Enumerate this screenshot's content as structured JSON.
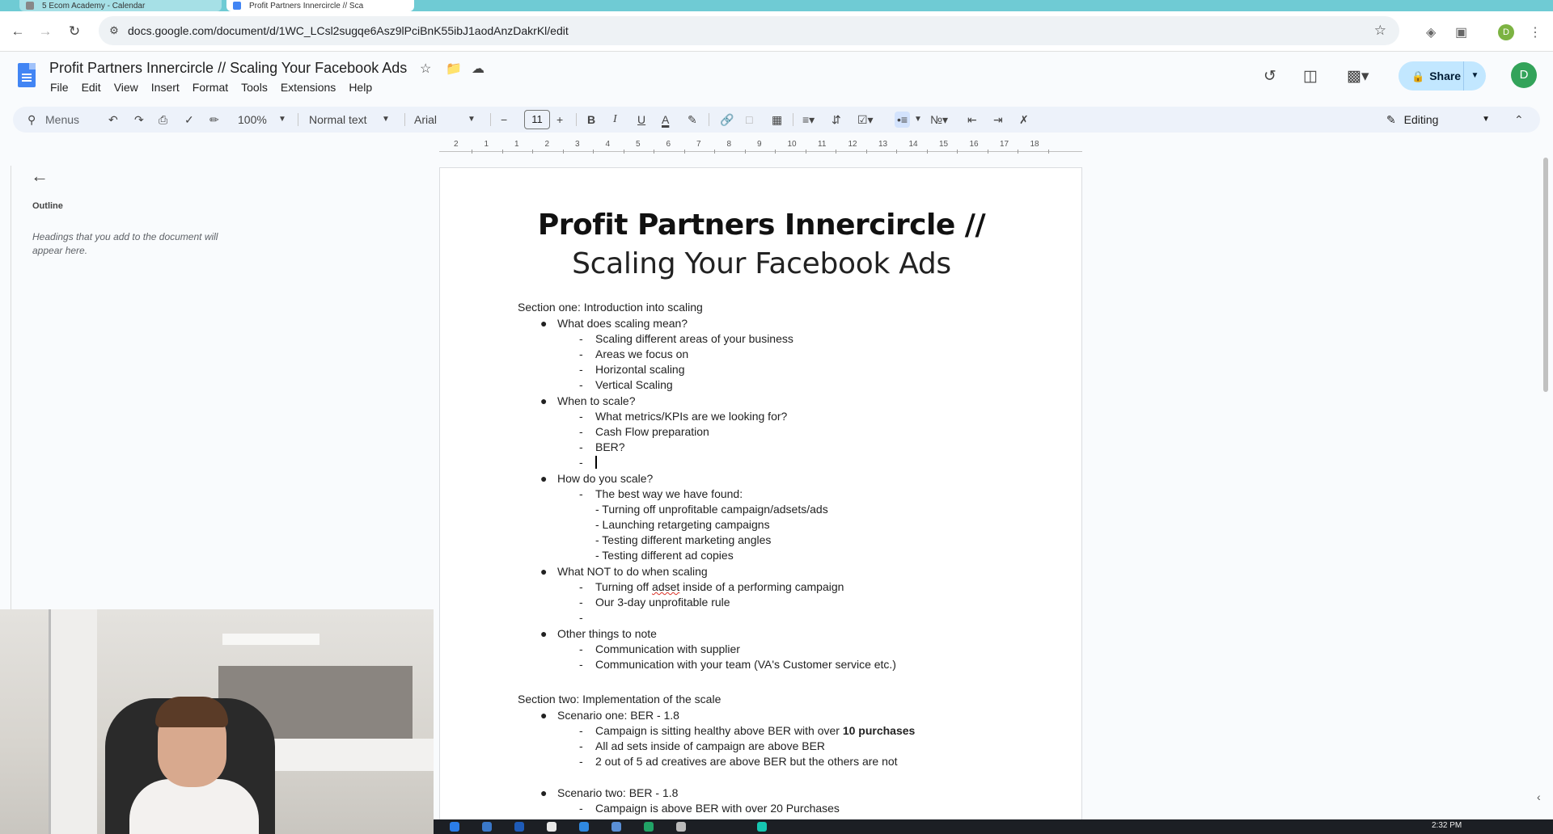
{
  "browser": {
    "tabs": [
      {
        "label": "5 Ecom Academy - Calendar"
      },
      {
        "label": "Profit Partners Innercircle // Sca"
      }
    ],
    "url": "docs.google.com/document/d/1WC_LCsl2sugqe6Asz9lPciBnK55ibJ1aodAnzDakrKl/edit",
    "profile_initial": "D"
  },
  "docs": {
    "title": "Profit Partners Innercircle // Scaling Your Facebook Ads",
    "menu": [
      "File",
      "Edit",
      "View",
      "Insert",
      "Format",
      "Tools",
      "Extensions",
      "Help"
    ],
    "share_label": "Share",
    "account_initial": "D"
  },
  "toolbar": {
    "menus_label": "Menus",
    "zoom": "100%",
    "style": "Normal text",
    "font": "Arial",
    "font_size": "11",
    "mode": "Editing"
  },
  "outline": {
    "label": "Outline",
    "hint": "Headings that you add to the document will appear here."
  },
  "ruler": {
    "numbers": [
      "2",
      "1",
      "1",
      "2",
      "3",
      "4",
      "5",
      "6",
      "7",
      "8",
      "9",
      "10",
      "11",
      "12",
      "13",
      "14",
      "15",
      "16",
      "17",
      "18"
    ]
  },
  "document": {
    "heading1": "Profit Partners Innercircle //",
    "heading2": "Scaling Your Facebook Ads",
    "section1": "Section one: Introduction into scaling",
    "b1": "What does scaling mean?",
    "b1_subs": [
      "Scaling different areas of your business",
      "Areas we focus on",
      "Horizontal scaling",
      "Vertical Scaling"
    ],
    "b2": "When to scale?",
    "b2_subs": [
      "What metrics/KPIs are we looking for?",
      "Cash Flow preparation",
      "BER?"
    ],
    "b3": "How do you scale?",
    "b3_first": "The best way we have found:",
    "b3_lines": [
      "- Turning off unprofitable campaign/adsets/ads",
      "- Launching retargeting campaigns",
      "- Testing different marketing angles",
      "- Testing different ad copies"
    ],
    "b4": "What NOT to do when scaling",
    "b4_sub1_pre": "Turning off ",
    "b4_sub1_err": "adset",
    "b4_sub1_post": " inside of a performing campaign",
    "b4_sub2": "Our 3-day unprofitable rule",
    "b5": "Other things to note",
    "b5_subs": [
      "Communication with supplier",
      "Communication with your team (VA's Customer service etc.)"
    ],
    "section2": "Section two: Implementation of the scale",
    "s1": "Scenario one: BER - 1.8",
    "s1_sub1_pre": "Campaign is sitting healthy above BER with over ",
    "s1_sub1_bold": "10 purchases",
    "s1_subs": [
      "All ad sets inside of campaign are above BER",
      "2 out of 5 ad creatives are above BER but the others are not"
    ],
    "s2": "Scenario two: BER - 1.8",
    "s2_sub1": "Campaign is above BER with over 20 Purchases"
  },
  "taskbar": {
    "clock": "2:32 PM"
  },
  "colors": {
    "tabstrip": "#6fcbd4",
    "share_bg": "#c2e7ff",
    "toolbar_bg": "#edf2fa",
    "docs_blue": "#4285f4",
    "account_green": "#33a35a"
  }
}
